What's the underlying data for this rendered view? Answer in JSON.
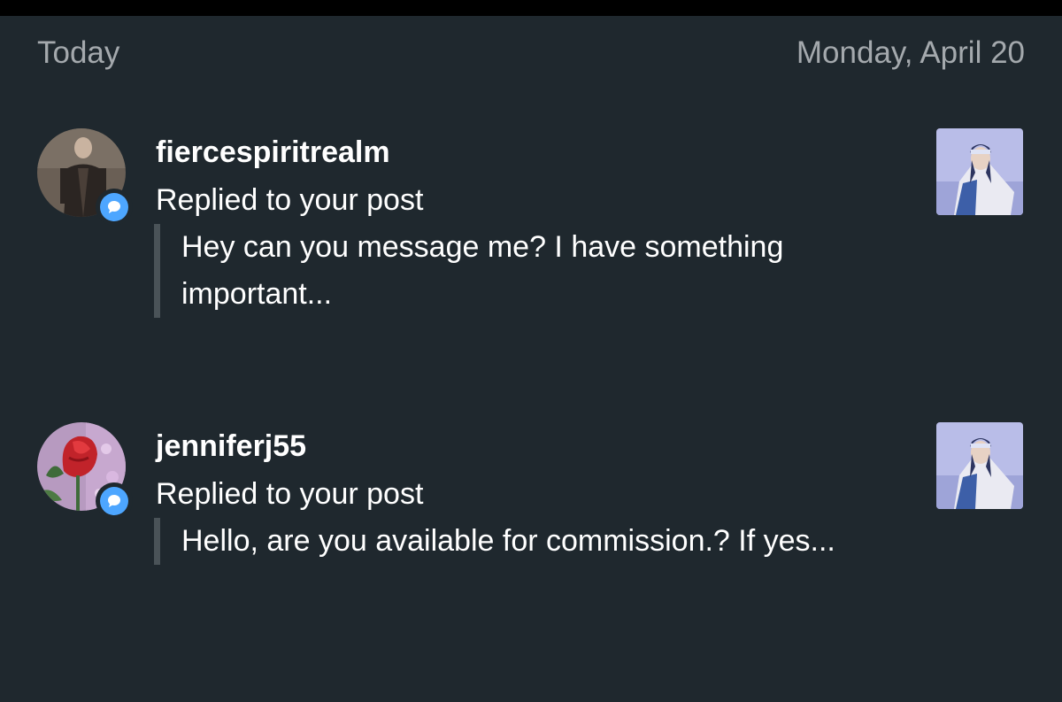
{
  "date_header": {
    "left": "Today",
    "right": "Monday, April 20"
  },
  "notifications": [
    {
      "username": "fiercespiritrealm",
      "action": "Replied to your post",
      "excerpt": "Hey can you message me? I have something important...",
      "badge_icon": "reply-bubble-icon"
    },
    {
      "username": "jenniferj55",
      "action": "Replied to your post",
      "excerpt": "Hello, are you available for commission.? If yes...",
      "badge_icon": "reply-bubble-icon"
    }
  ],
  "colors": {
    "background": "#1f282e",
    "badge": "#4da6ff",
    "muted_text": "#a4a9ad"
  }
}
